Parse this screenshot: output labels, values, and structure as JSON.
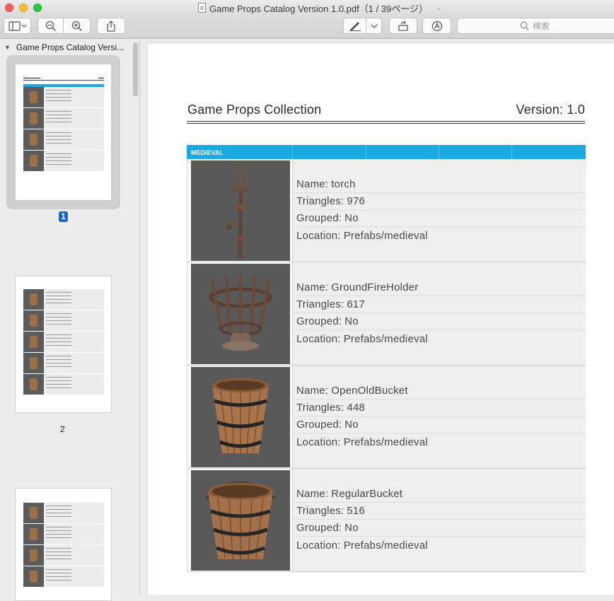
{
  "window": {
    "title": "Game Props Catalog Version 1.0.pdf（1 / 39ページ）"
  },
  "toolbar": {
    "search_placeholder": "検索"
  },
  "sidebar": {
    "doc_title": "Game Props Catalog Versi...",
    "pages": [
      {
        "label": "1",
        "selected": true
      },
      {
        "label": "2",
        "selected": false
      }
    ]
  },
  "document": {
    "header_title": "Game Props Collection",
    "header_version": "Version: 1.0",
    "section": "MEDIEVAL",
    "field_labels": {
      "name": "Name:",
      "triangles": "Triangles:",
      "grouped": "Grouped:",
      "location": "Location:"
    },
    "items": [
      {
        "name": "torch",
        "triangles": "976",
        "grouped": "No",
        "location": "Prefabs/medieval"
      },
      {
        "name": "GroundFireHolder",
        "triangles": "617",
        "grouped": "No",
        "location": "Prefabs/medieval"
      },
      {
        "name": "OpenOldBucket",
        "triangles": "448",
        "grouped": "No",
        "location": "Prefabs/medieval"
      },
      {
        "name": "RegularBucket",
        "triangles": "516",
        "grouped": "No",
        "location": "Prefabs/medieval"
      }
    ]
  },
  "colors": {
    "section_header": "#1ba9e1",
    "selection": "#1565d8"
  }
}
